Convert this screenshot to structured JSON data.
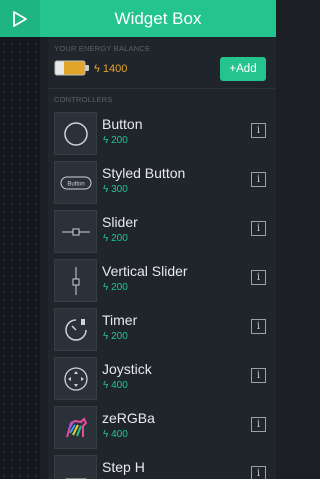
{
  "header": {
    "title": "Widget Box",
    "play_icon": "play-icon"
  },
  "energy": {
    "label": "YOUR ENERGY BALANCE",
    "amount": "1400",
    "bolt": "ϟ",
    "add_label": "+Add"
  },
  "controllers": {
    "label": "CONTROLLERS",
    "items": [
      {
        "name": "Button",
        "cost": "200",
        "icon": "button-circle-icon"
      },
      {
        "name": "Styled Button",
        "cost": "300",
        "icon": "styled-button-icon",
        "icon_text": "Button"
      },
      {
        "name": "Slider",
        "cost": "200",
        "icon": "horizontal-slider-icon"
      },
      {
        "name": "Vertical Slider",
        "cost": "200",
        "icon": "vertical-slider-icon"
      },
      {
        "name": "Timer",
        "cost": "200",
        "icon": "timer-icon"
      },
      {
        "name": "Joystick",
        "cost": "400",
        "icon": "joystick-icon"
      },
      {
        "name": "zeRGBa",
        "cost": "400",
        "icon": "zebra-icon"
      },
      {
        "name": "Step H",
        "cost": "",
        "icon": "step-h-icon"
      }
    ],
    "info_label": "i"
  },
  "colors": {
    "accent": "#23c48e",
    "energy": "#e3a529",
    "background": "#1b1f24"
  }
}
